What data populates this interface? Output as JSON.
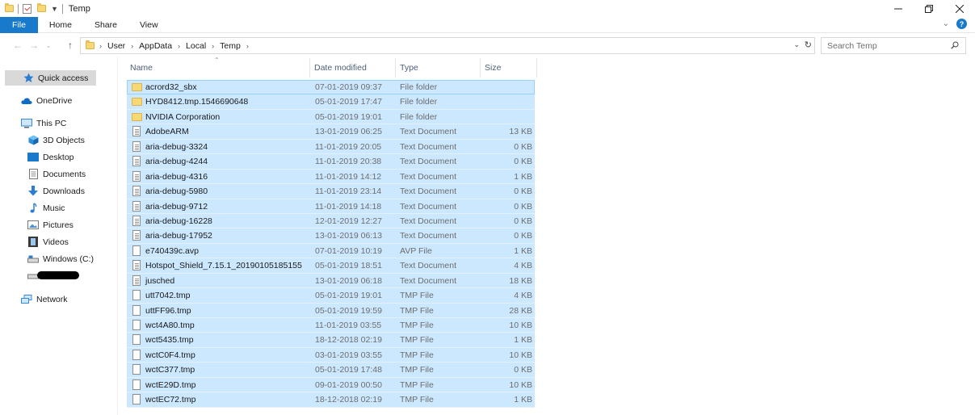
{
  "window": {
    "title": "Temp"
  },
  "ribbon": {
    "tabs": [
      "File",
      "Home",
      "Share",
      "View"
    ]
  },
  "address": {
    "crumbs": [
      "User",
      "AppData",
      "Local",
      "Temp"
    ]
  },
  "search": {
    "placeholder": "Search Temp"
  },
  "nav": {
    "items": [
      {
        "label": "Quick access",
        "icon": "star-icon"
      },
      {
        "label": "OneDrive",
        "icon": "cloud-icon"
      },
      {
        "label": "This PC",
        "icon": "computer-icon"
      },
      {
        "label": "3D Objects",
        "icon": "cube-icon"
      },
      {
        "label": "Desktop",
        "icon": "desktop-icon"
      },
      {
        "label": "Documents",
        "icon": "document-icon"
      },
      {
        "label": "Downloads",
        "icon": "download-arrow-icon"
      },
      {
        "label": "Music",
        "icon": "music-note-icon"
      },
      {
        "label": "Pictures",
        "icon": "picture-icon"
      },
      {
        "label": "Videos",
        "icon": "film-icon"
      },
      {
        "label": "Windows (C:)",
        "icon": "drive-icon"
      },
      {
        "label": "",
        "icon": "drive-icon"
      },
      {
        "label": "Network",
        "icon": "network-icon"
      }
    ]
  },
  "columns": {
    "name": "Name",
    "date": "Date modified",
    "type": "Type",
    "size": "Size"
  },
  "files": [
    {
      "name": "acrord32_sbx",
      "date": "07-01-2019 09:37",
      "type": "File folder",
      "size": "",
      "kind": "folder"
    },
    {
      "name": "HYD8412.tmp.1546690648",
      "date": "05-01-2019 17:47",
      "type": "File folder",
      "size": "",
      "kind": "folder"
    },
    {
      "name": "NVIDIA Corporation",
      "date": "05-01-2019 19:01",
      "type": "File folder",
      "size": "",
      "kind": "folder"
    },
    {
      "name": "AdobeARM",
      "date": "13-01-2019 06:25",
      "type": "Text Document",
      "size": "13 KB",
      "kind": "text"
    },
    {
      "name": "aria-debug-3324",
      "date": "11-01-2019 20:05",
      "type": "Text Document",
      "size": "0 KB",
      "kind": "text"
    },
    {
      "name": "aria-debug-4244",
      "date": "11-01-2019 20:38",
      "type": "Text Document",
      "size": "0 KB",
      "kind": "text"
    },
    {
      "name": "aria-debug-4316",
      "date": "11-01-2019 14:12",
      "type": "Text Document",
      "size": "1 KB",
      "kind": "text"
    },
    {
      "name": "aria-debug-5980",
      "date": "11-01-2019 23:14",
      "type": "Text Document",
      "size": "0 KB",
      "kind": "text"
    },
    {
      "name": "aria-debug-9712",
      "date": "11-01-2019 14:18",
      "type": "Text Document",
      "size": "0 KB",
      "kind": "text"
    },
    {
      "name": "aria-debug-16228",
      "date": "12-01-2019 12:27",
      "type": "Text Document",
      "size": "0 KB",
      "kind": "text"
    },
    {
      "name": "aria-debug-17952",
      "date": "13-01-2019 06:13",
      "type": "Text Document",
      "size": "0 KB",
      "kind": "text"
    },
    {
      "name": "e740439c.avp",
      "date": "07-01-2019 10:19",
      "type": "AVP File",
      "size": "1 KB",
      "kind": "blank"
    },
    {
      "name": "Hotspot_Shield_7.15.1_20190105185155",
      "date": "05-01-2019 18:51",
      "type": "Text Document",
      "size": "4 KB",
      "kind": "text"
    },
    {
      "name": "jusched",
      "date": "13-01-2019 06:18",
      "type": "Text Document",
      "size": "18 KB",
      "kind": "text"
    },
    {
      "name": "utt7042.tmp",
      "date": "05-01-2019 19:01",
      "type": "TMP File",
      "size": "4 KB",
      "kind": "blank"
    },
    {
      "name": "uttFF96.tmp",
      "date": "05-01-2019 19:59",
      "type": "TMP File",
      "size": "28 KB",
      "kind": "blank"
    },
    {
      "name": "wct4A80.tmp",
      "date": "11-01-2019 03:55",
      "type": "TMP File",
      "size": "10 KB",
      "kind": "blank"
    },
    {
      "name": "wct5435.tmp",
      "date": "18-12-2018 02:19",
      "type": "TMP File",
      "size": "1 KB",
      "kind": "blank"
    },
    {
      "name": "wctC0F4.tmp",
      "date": "03-01-2019 03:55",
      "type": "TMP File",
      "size": "10 KB",
      "kind": "blank"
    },
    {
      "name": "wctC377.tmp",
      "date": "05-01-2019 17:48",
      "type": "TMP File",
      "size": "0 KB",
      "kind": "blank"
    },
    {
      "name": "wctE29D.tmp",
      "date": "09-01-2019 00:50",
      "type": "TMP File",
      "size": "10 KB",
      "kind": "blank"
    },
    {
      "name": "wctEC72.tmp",
      "date": "18-12-2018 02:19",
      "type": "TMP File",
      "size": "1 KB",
      "kind": "blank"
    }
  ]
}
